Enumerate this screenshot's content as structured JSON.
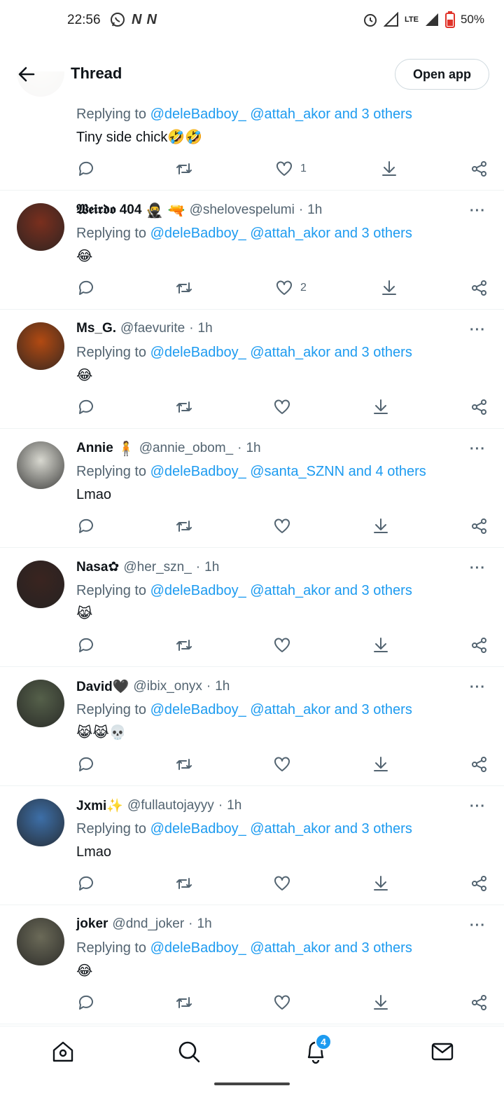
{
  "status_bar": {
    "time": "22:56",
    "network": "LTE",
    "battery": "50%",
    "icons": [
      "whatsapp-icon",
      "n-icon",
      "n-icon",
      "alarm-icon",
      "signal-icon",
      "battery-icon"
    ]
  },
  "header": {
    "title": "Thread",
    "open_app_label": "Open app"
  },
  "replying_label": "Replying to",
  "tweets": [
    {
      "name": "",
      "handle": "",
      "time": "",
      "mentions": "@deleBadboy_ @attah_akor and 3 others",
      "text": "Tiny side chick",
      "emoji": "🤣🤣",
      "like_count": "1",
      "avatar_color": "#c9b48a"
    },
    {
      "name": "𝖂𝖊𝖎𝖗𝖉𝖔 404",
      "name_emoji": "🥷 🔫",
      "handle": "@shelovespelumi",
      "time": "1h",
      "mentions": "@deleBadboy_ @attah_akor and 3 others",
      "text": "",
      "emoji": "😂",
      "like_count": "2",
      "avatar_color": "#7a2f1e"
    },
    {
      "name": "Ms_G.",
      "name_emoji": "",
      "handle": "@faevurite",
      "time": "1h",
      "mentions": "@deleBadboy_ @attah_akor and 3 others",
      "text": "",
      "emoji": "😂",
      "like_count": "",
      "avatar_color": "#b24a12"
    },
    {
      "name": "Annie",
      "name_emoji": "🧍",
      "handle": "@annie_obom_",
      "time": "1h",
      "mentions": "@deleBadboy_ @santa_SZNN and 4 others",
      "text": "Lmao",
      "emoji": "",
      "like_count": "",
      "avatar_color": "#d8d8d0"
    },
    {
      "name": "Nasa✿",
      "name_emoji": "",
      "handle": "@her_szn_",
      "time": "1h",
      "mentions": "@deleBadboy_ @attah_akor and 3 others",
      "text": "",
      "emoji": "😹",
      "like_count": "",
      "avatar_color": "#3a2420"
    },
    {
      "name": "David🖤",
      "name_emoji": "",
      "handle": "@ibix_onyx",
      "time": "1h",
      "mentions": "@deleBadboy_ @attah_akor and 3 others",
      "text": "",
      "emoji": "😹😹💀",
      "like_count": "",
      "avatar_color": "#55604a"
    },
    {
      "name": "Jxmi✨",
      "name_emoji": "",
      "handle": "@fullautojayyy",
      "time": "1h",
      "mentions": "@deleBadboy_ @attah_akor and 3 others",
      "text": "Lmao",
      "emoji": "",
      "like_count": "",
      "avatar_color": "#3d6fa8"
    },
    {
      "name": "joker",
      "name_emoji": "",
      "handle": "@dnd_joker",
      "time": "1h",
      "mentions": "@deleBadboy_ @attah_akor and 3 others",
      "text": "",
      "emoji": "😂",
      "like_count": "",
      "avatar_color": "#6b6a58"
    }
  ],
  "bottom_nav": {
    "items": [
      "home-icon",
      "search-icon",
      "notifications-icon",
      "messages-icon"
    ],
    "notification_badge": "4"
  },
  "colors": {
    "accent": "#1d9bf0",
    "secondary_text": "#536471",
    "divider": "#eff3f4"
  }
}
